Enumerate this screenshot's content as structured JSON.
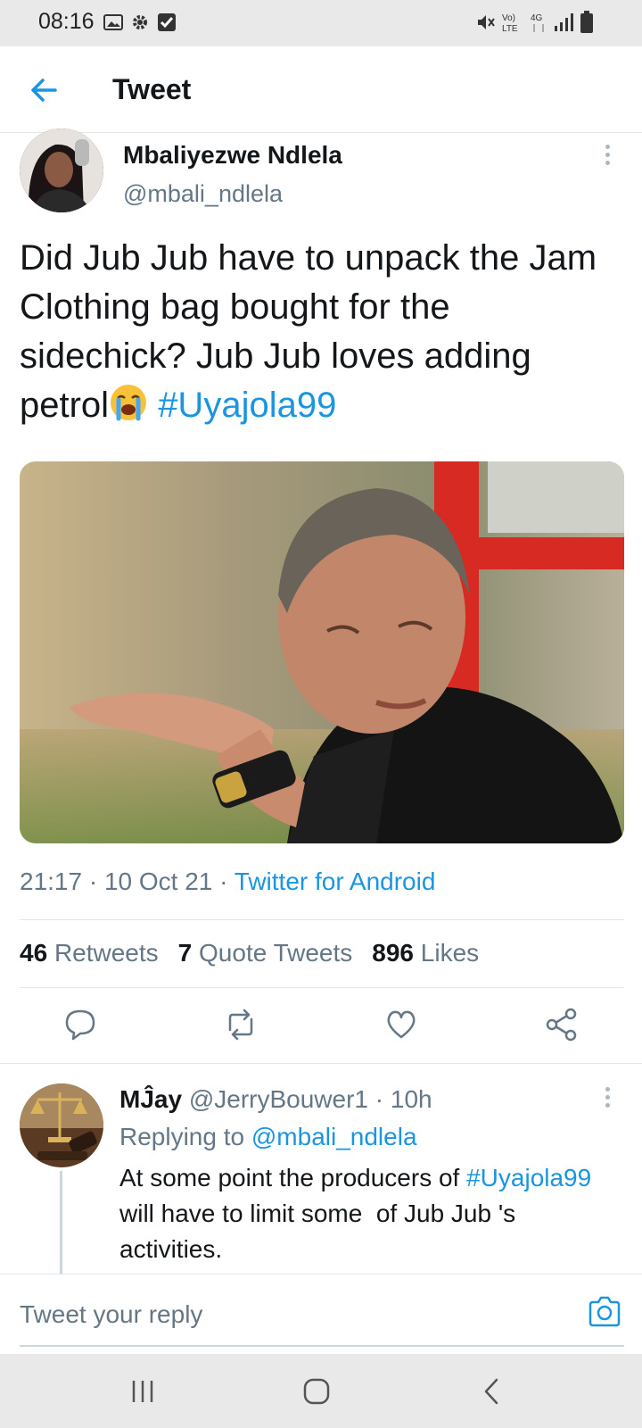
{
  "status_bar": {
    "time": "08:16",
    "left_icons": [
      "image-icon",
      "gear-icon",
      "checkbox-icon"
    ],
    "right_icons": [
      "mute-icon",
      "volte-icon",
      "4g-icon",
      "signal-icon",
      "battery-icon"
    ]
  },
  "header": {
    "title": "Tweet",
    "back_icon": "back-arrow-icon"
  },
  "tweet": {
    "author_name": "Mbaliyezwe Ndlela",
    "author_handle": "@mbali_ndlela",
    "text": "Did Jub Jub have to unpack the Jam Clothing bag bought for the sidechick? Jub Jub loves adding petrol",
    "emoji": "loudly-crying-face-emoji",
    "hashtag": "#Uyajola99",
    "time": "21:17",
    "date": "10 Oct 21",
    "separator": "·",
    "source": "Twitter for Android",
    "stats": {
      "retweets_count": "46",
      "retweets_label": "Retweets",
      "quotes_count": "7",
      "quotes_label": "Quote Tweets",
      "likes_count": "896",
      "likes_label": "Likes"
    },
    "action_icons": [
      "reply-icon",
      "retweet-icon",
      "like-icon",
      "share-icon"
    ]
  },
  "reply": {
    "name": "MĴay",
    "handle": "@JerryBouwer1",
    "age": "10h",
    "replying_prefix": "Replying to",
    "replying_to": "@mbali_ndlela",
    "text_before": "At some point the producers of ",
    "hashtag": "#Uyajola99",
    "text_after": "  will have to limit some  of Jub Jub 's activities."
  },
  "composer": {
    "placeholder": "Tweet your reply",
    "camera_icon": "camera-icon"
  },
  "nav_bar": {
    "icons": [
      "recent-apps-icon",
      "home-icon",
      "back-icon"
    ]
  },
  "colors": {
    "accent": "#1b95e0",
    "secondary_text": "#657786",
    "primary_text": "#14171a",
    "divider": "#e1e8ed",
    "system_bar": "#e9e9e9"
  }
}
